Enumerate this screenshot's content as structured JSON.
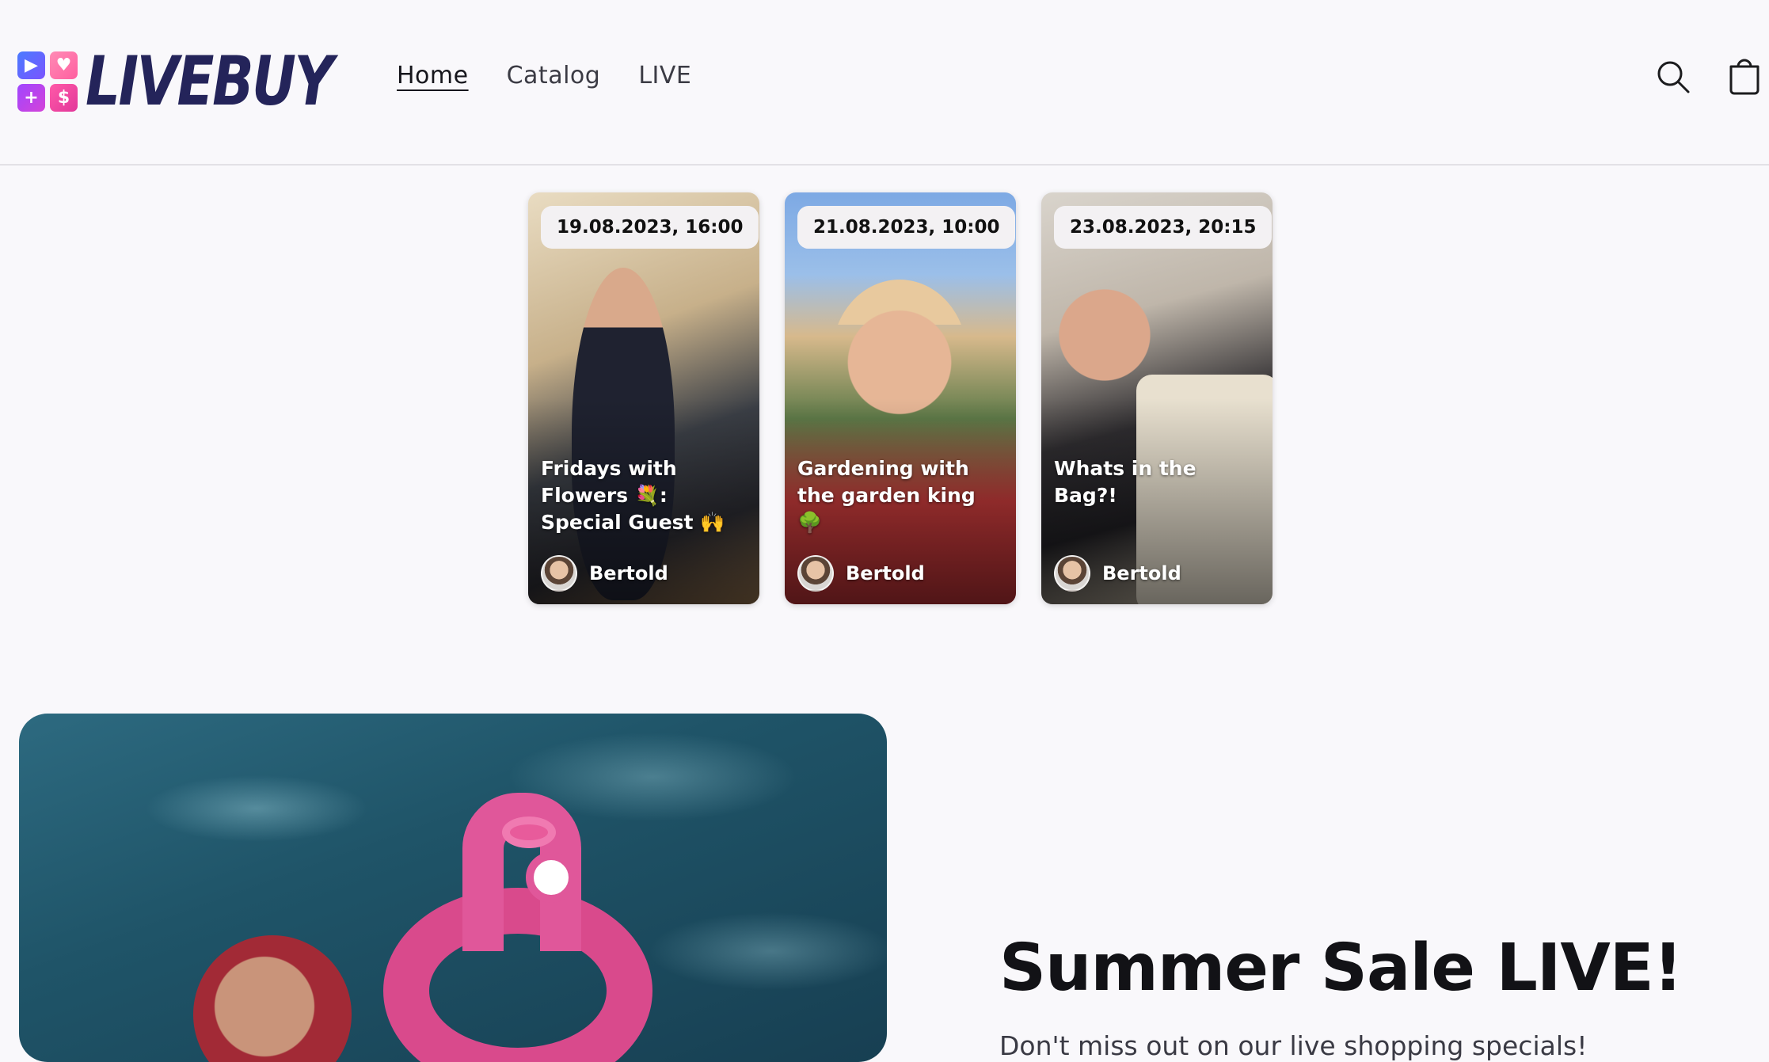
{
  "brand": {
    "name": "LIVEBUY",
    "colors": {
      "navy": "#24245a",
      "pink": "#e0579a",
      "purple": "#a046ff",
      "blue": "#4a7bff"
    }
  },
  "nav": {
    "items": [
      {
        "label": "Home",
        "active": true
      },
      {
        "label": "Catalog",
        "active": false
      },
      {
        "label": "LIVE",
        "active": false
      }
    ]
  },
  "header_icons": {
    "search": "search-icon",
    "cart": "cart-icon"
  },
  "live_events": [
    {
      "date": "19.08.2023, 16:00",
      "title": "Fridays with Flowers 💐: Special Guest 🙌",
      "host": "Bertold"
    },
    {
      "date": "21.08.2023, 10:00",
      "title": "Gardening with the garden king 🌳",
      "host": "Bertold"
    },
    {
      "date": "23.08.2023, 20:15",
      "title": "Whats in the Bag?!",
      "host": "Bertold"
    }
  ],
  "banner": {
    "title": "Summer Sale LIVE!",
    "subtitle": "Don't miss out on our live shopping specials!"
  }
}
